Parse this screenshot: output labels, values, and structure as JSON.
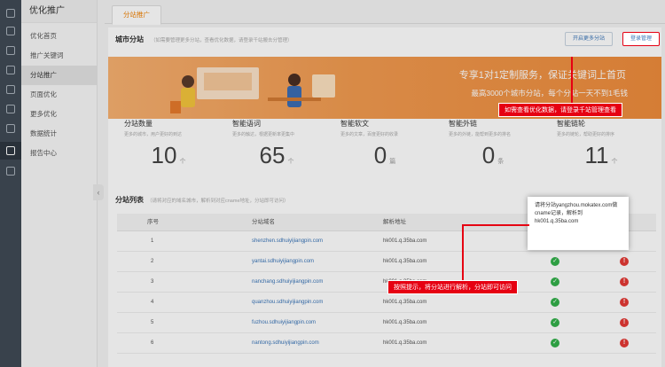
{
  "sidebar": {
    "title": "优化推广",
    "items": [
      {
        "label": "优化首页"
      },
      {
        "label": "推广关键词"
      },
      {
        "label": "分站推广"
      },
      {
        "label": "页面优化"
      },
      {
        "label": "更多优化"
      },
      {
        "label": "数据统计"
      },
      {
        "label": "报告中心"
      }
    ],
    "active_index": 2
  },
  "tab": {
    "label": "分站推广"
  },
  "city": {
    "title": "城市分站",
    "hint": "（如需要管理更多分站，查看优化数据，请登录千站搬去分管理）",
    "open_more": "开启更多分站",
    "login_manage": "登录管理"
  },
  "banner": {
    "line1": "专享1对1定制服务，保证关键词上首页",
    "line2": "最高3000个城市分站，每个分站一天不到1毛钱",
    "tip": "如需查看优化数据，请登录千站管理查看"
  },
  "stats": [
    {
      "title": "分站数量",
      "desc": "更多的城市，用户更好的到达",
      "value": "10",
      "unit": "个"
    },
    {
      "title": "智能语词",
      "desc": "更多的触达，根据更新率更集中",
      "value": "65",
      "unit": "个"
    },
    {
      "title": "智能软文",
      "desc": "更多的文章，百度更好的收录",
      "value": "0",
      "unit": "篇"
    },
    {
      "title": "智能外链",
      "desc": "更多的外链，能帮到更多的排名",
      "value": "0",
      "unit": "条"
    },
    {
      "title": "智能链轮",
      "desc": "更多的链轮，帮助更好的排序",
      "value": "11",
      "unit": "个"
    }
  ],
  "list": {
    "title": "分站列表",
    "hint": "（请将对应的域名城市，解析到对应cname地址，分站即可访问）",
    "headers": {
      "no": "序号",
      "domain": "分站域名",
      "cname": "解析地址"
    },
    "rows": [
      {
        "no": "1",
        "domain": "shenzhen.sdhuiyijiangpin.com",
        "cname": "hk001.q.35ba.com"
      },
      {
        "no": "2",
        "domain": "yantai.sdhuiyijiangpin.com",
        "cname": "hk001.q.35ba.com"
      },
      {
        "no": "3",
        "domain": "nanchang.sdhuiyijiangpin.com",
        "cname": "hk001.q.35ba.com"
      },
      {
        "no": "4",
        "domain": "quanzhou.sdhuiyijiangpin.com",
        "cname": "hk001.q.35ba.com"
      },
      {
        "no": "5",
        "domain": "fuzhou.sdhuiyijiangpin.com",
        "cname": "hk001.q.35ba.com"
      },
      {
        "no": "6",
        "domain": "nantong.sdhuiyijiangpin.com",
        "cname": "hk001.q.35ba.com"
      }
    ]
  },
  "popup": {
    "text": "请将分站yangzhou.mokatex.com做cname记录，解析到hk001.q.35ba.com"
  },
  "annotation": {
    "text": "按照提示，将分站进行解析，分站即可访问"
  },
  "colors": {
    "accent": "#f08000",
    "tip_red": "#e60012",
    "link": "#3a75b8",
    "ok": "#33b04a",
    "error": "#e53935"
  }
}
